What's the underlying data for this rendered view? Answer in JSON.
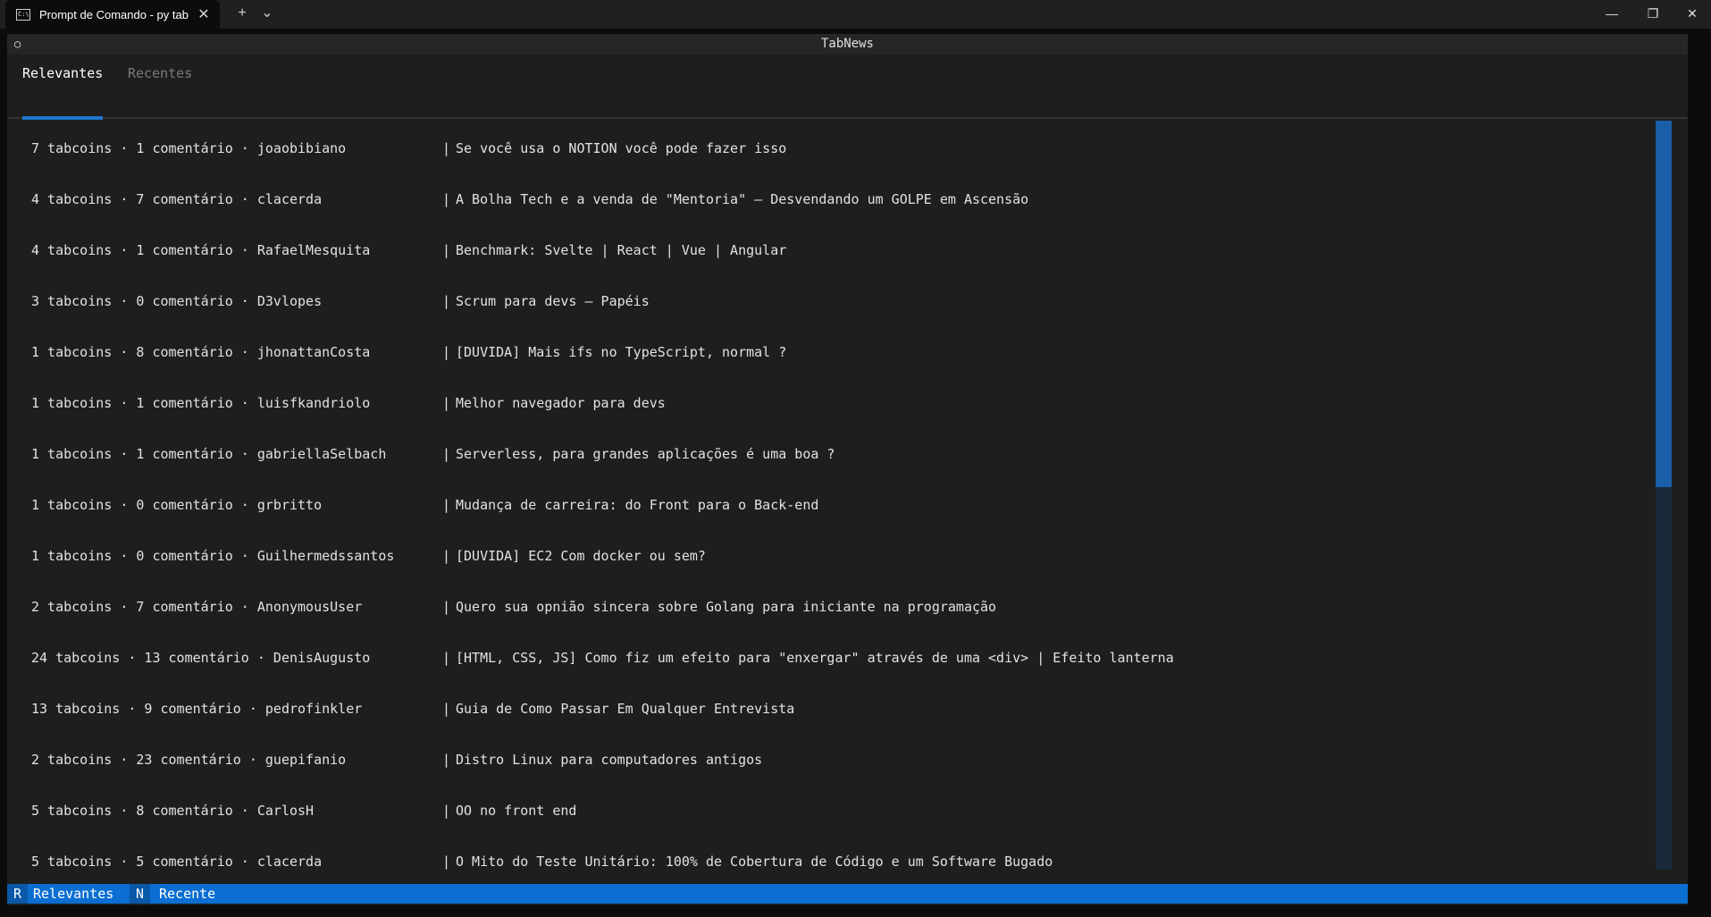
{
  "window": {
    "tab_label": "Prompt de Comando - py  tab",
    "tab_icon_text": "C:\\",
    "new_tab": "+",
    "dropdown": "⌄",
    "minimize": "—",
    "maximize": "❐",
    "close": "✕",
    "tab_close": "✕"
  },
  "app": {
    "title": "TabNews",
    "status_glyph": "○",
    "tabs": [
      {
        "label": "Relevantes",
        "active": true
      },
      {
        "label": "Recentes",
        "active": false
      }
    ]
  },
  "posts": [
    {
      "meta": "7 tabcoins · 1 comentário · joaobibiano",
      "title": "Se você usa o NOTION você pode fazer isso"
    },
    {
      "meta": "4 tabcoins · 7 comentário · clacerda",
      "title": "A Bolha Tech e a venda de \"Mentoria\" – Desvendando um GOLPE em Ascensão"
    },
    {
      "meta": "4 tabcoins · 1 comentário · RafaelMesquita",
      "title": "Benchmark: Svelte | React | Vue | Angular"
    },
    {
      "meta": "3 tabcoins · 0 comentário · D3vlopes",
      "title": "Scrum para devs – Papéis"
    },
    {
      "meta": "1 tabcoins · 8 comentário · jhonattanCosta",
      "title": "[DUVIDA] Mais ifs no TypeScript, normal ?"
    },
    {
      "meta": "1 tabcoins · 1 comentário · luisfkandriolo",
      "title": "Melhor navegador para devs"
    },
    {
      "meta": "1 tabcoins · 1 comentário · gabriellaSelbach",
      "title": "Serverless, para grandes aplicações é uma boa ?"
    },
    {
      "meta": "1 tabcoins · 0 comentário · grbritto",
      "title": "Mudança de carreira: do Front para o Back-end"
    },
    {
      "meta": "1 tabcoins · 0 comentário · Guilhermedssantos",
      "title": "[DUVIDA] EC2 Com docker ou sem?"
    },
    {
      "meta": "2 tabcoins · 7 comentário · AnonymousUser",
      "title": "Quero sua opnião sincera sobre Golang para iniciante na programação"
    },
    {
      "meta": "24 tabcoins · 13 comentário · DenisAugusto",
      "title": "[HTML, CSS, JS] Como fiz um efeito para \"enxergar\" através de uma <div> | Efeito lanterna"
    },
    {
      "meta": "13 tabcoins · 9 comentário · pedrofinkler",
      "title": "Guia de Como Passar Em Qualquer Entrevista"
    },
    {
      "meta": "2 tabcoins · 23 comentário · guepifanio",
      "title": "Distro Linux para computadores antigos"
    },
    {
      "meta": "5 tabcoins · 8 comentário · CarlosH",
      "title": "OO no front end"
    },
    {
      "meta": "5 tabcoins · 5 comentário · clacerda",
      "title": "O Mito do Teste Unitário: 100% de Cobertura de Código e um Software Bugado"
    }
  ],
  "separator": "|",
  "footer": {
    "items": [
      {
        "key": "R",
        "label": "Relevantes"
      },
      {
        "key": "N",
        "label": "Recente"
      }
    ]
  },
  "scroll_position_fraction": 0.0
}
